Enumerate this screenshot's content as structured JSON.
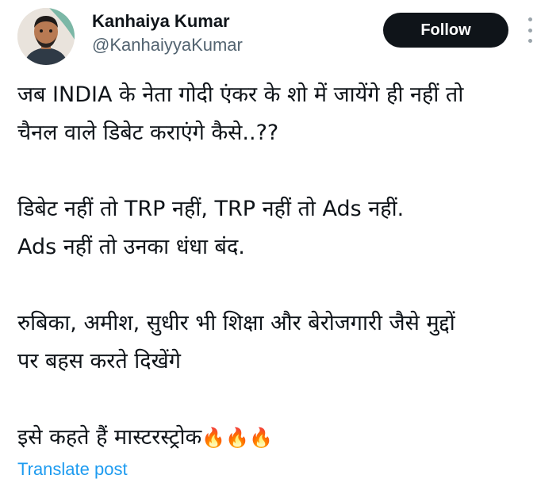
{
  "user": {
    "name": "Kanhaiya Kumar",
    "handle": "@KanhaiyyaKumar"
  },
  "actions": {
    "follow_label": "Follow",
    "more_icon": "more-vertical-icon"
  },
  "post": {
    "lines": [
      "जब INDIA के नेता गोदी एंकर के शो में जायेंगे ही नहीं तो",
      "चैनल वाले डिबेट कराएंगे कैसे..??",
      "डिबेट नहीं तो TRP नहीं, TRP नहीं तो Ads नहीं.",
      "Ads नहीं तो उनका धंधा बंद.",
      "रुबिका, अमीश, सुधीर भी शिक्षा और बेरोजगारी जैसे मुद्दों",
      "पर बहस करते दिखेंगे",
      "इसे कहते हैं मास्टरस्ट्रोक"
    ],
    "emoji": "🔥🔥🔥"
  },
  "footer": {
    "translate_label": "Translate post"
  },
  "colors": {
    "text": "#0f1419",
    "secondary": "#536471",
    "link": "#1d9bf0",
    "button_bg": "#0f1419"
  }
}
